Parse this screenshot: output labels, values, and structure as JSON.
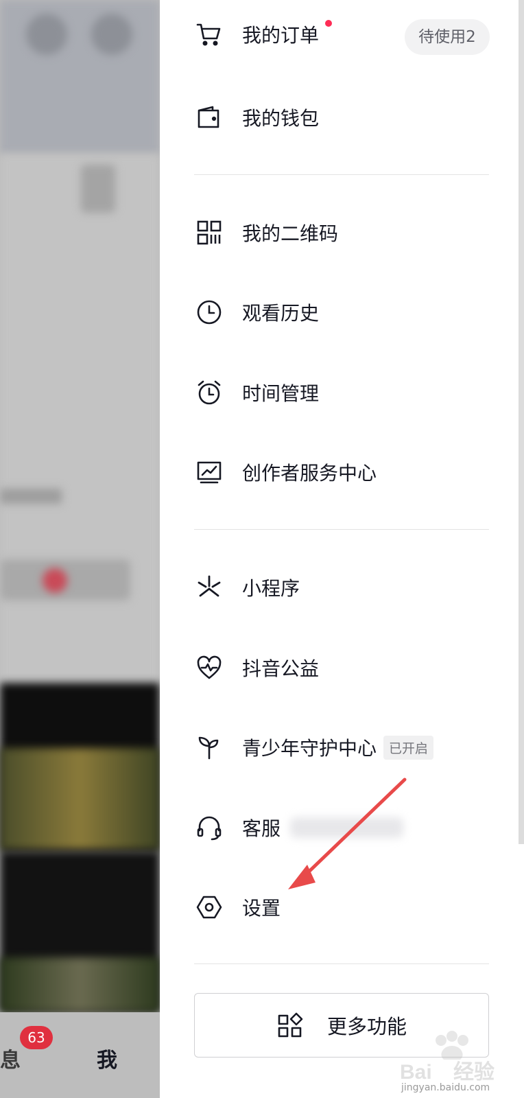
{
  "background_page": {
    "tabs": {
      "messages_label": "消息",
      "messages_badge": "63",
      "me_label": "我"
    }
  },
  "drawer": {
    "items": [
      {
        "label": "我的订单",
        "icon": "cart-icon",
        "badge": "待使用2"
      },
      {
        "label": "我的钱包",
        "icon": "wallet-icon"
      },
      {
        "label": "我的二维码",
        "icon": "qrcode-icon"
      },
      {
        "label": "观看历史",
        "icon": "clock-icon"
      },
      {
        "label": "时间管理",
        "icon": "alarm-clock-icon"
      },
      {
        "label": "创作者服务中心",
        "icon": "chart-monitor-icon"
      },
      {
        "label": "小程序",
        "icon": "mini-program-icon"
      },
      {
        "label": "抖音公益",
        "icon": "heart-chart-icon"
      },
      {
        "label": "青少年守护中心",
        "icon": "sprout-icon",
        "tag": "已开启"
      },
      {
        "label": "客服",
        "icon": "headset-icon"
      },
      {
        "label": "设置",
        "icon": "hexagon-settings-icon"
      }
    ],
    "more_button": {
      "label": "更多功能",
      "icon": "grid-diamond-icon"
    }
  },
  "colors": {
    "accent": "#fe2c55",
    "annotation_arrow": "#e84a4a",
    "text": "#161823"
  },
  "watermark": {
    "text": "jingyan.baidu.com",
    "logo": "Baidu 经验"
  }
}
